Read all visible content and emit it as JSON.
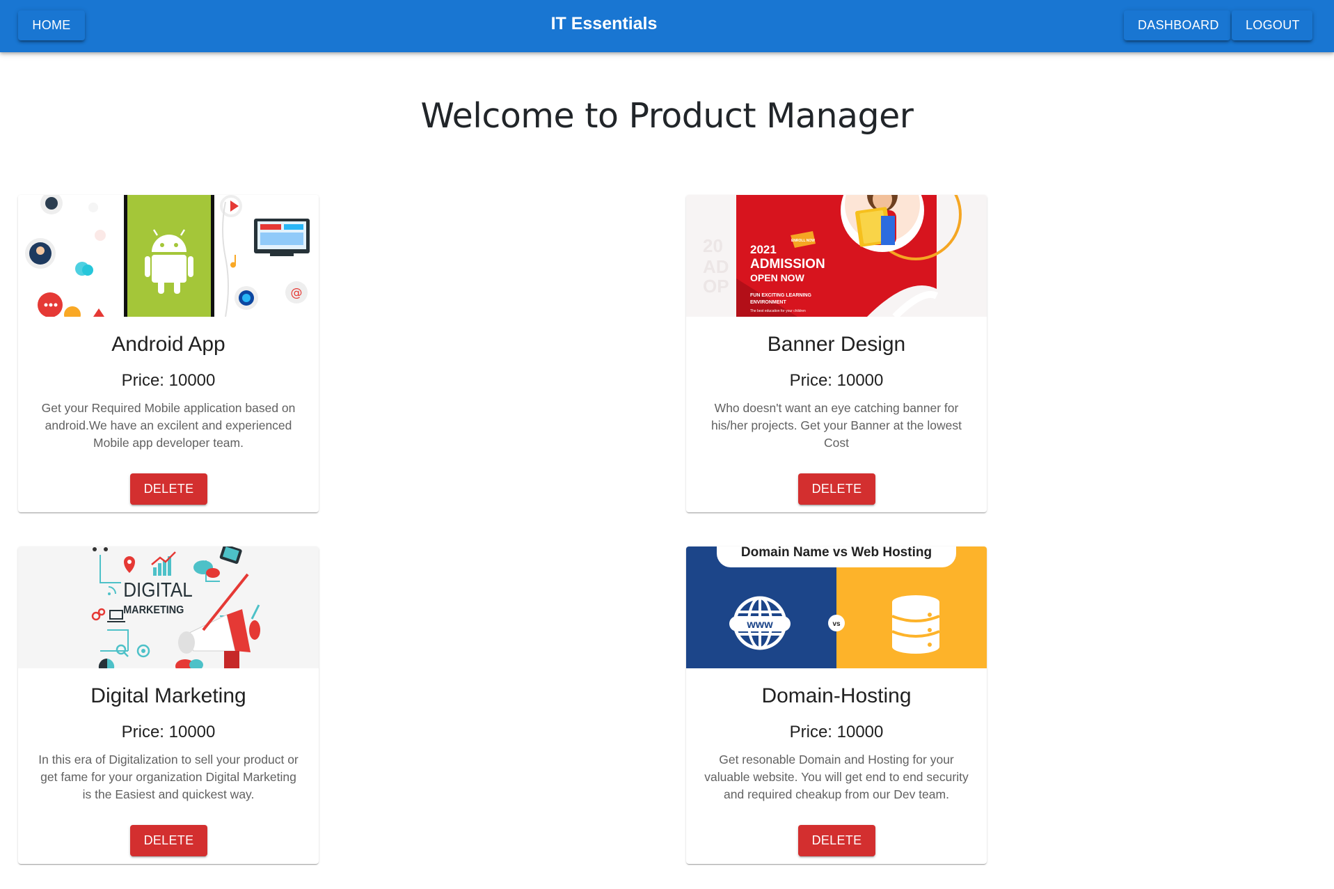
{
  "appbar": {
    "home_label": "HOME",
    "title": "IT Essentials",
    "dashboard_label": "DASHBOARD",
    "logout_label": "LOGOUT",
    "color": "#1976d2"
  },
  "page": {
    "title": "Welcome to Product Manager"
  },
  "products": [
    {
      "name": "Android App",
      "price": "Price: 10000",
      "description": "Get your Required Mobile application based on android.We have an excilent and experienced Mobile app developer team.",
      "delete_label": "DELETE",
      "image": "android-app-illustration"
    },
    {
      "name": "Banner Design",
      "price": "Price: 10000",
      "description": "Who doesn't want an eye catching banner for his/her projects. Get your Banner at the lowest Cost",
      "delete_label": "DELETE",
      "image": "admission-banner-illustration",
      "image_text": {
        "line1": "2021",
        "line2": "ADMISSION",
        "line3": "OPEN NOW",
        "line4": "FUN EXCITING LEARNING",
        "line5": "ENVIRONMENT",
        "line6": "The best education for your children",
        "badge": "ENROLL NOW",
        "bg_text_1": "20",
        "bg_text_2": "AD",
        "bg_text_3": "OP"
      }
    },
    {
      "name": "Digital Marketing",
      "price": "Price: 10000",
      "description": "In this era of Digitalization to sell your product or get fame for your organization Digital Marketing is the Easiest and quickest way.",
      "delete_label": "DELETE",
      "image": "digital-marketing-illustration",
      "image_text": {
        "line1": "DIGITAL",
        "line2": "MARKETING"
      }
    },
    {
      "name": "Domain-Hosting",
      "price": "Price: 10000",
      "description": "Get resonable Domain and Hosting for your valuable website. You will get end to end security and required cheakup from our Dev team.",
      "delete_label": "DELETE",
      "image": "domain-vs-hosting-illustration",
      "image_text": {
        "heading": "Domain Name vs Web Hosting",
        "www": "www",
        "vs": "vs"
      }
    }
  ],
  "colors": {
    "delete_button": "#d32f2f",
    "android_green": "#a4c639",
    "banner_red": "#d7141e",
    "domain_blue": "#1c4589",
    "hosting_yellow": "#fdb32a"
  }
}
